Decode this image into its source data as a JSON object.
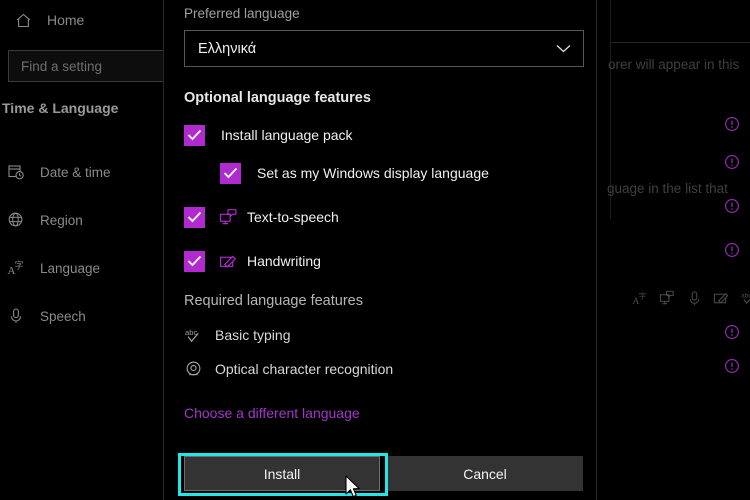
{
  "sidebar": {
    "home": {
      "label": "Home",
      "icon": "home-icon"
    },
    "search": {
      "placeholder": "Find a setting"
    },
    "section_title": "Time & Language",
    "items": [
      {
        "label": "Date & time",
        "icon": "calendar-clock-icon"
      },
      {
        "label": "Region",
        "icon": "globe-icon"
      },
      {
        "label": "Language",
        "icon": "language-icon"
      },
      {
        "label": "Speech",
        "icon": "microphone-icon"
      }
    ]
  },
  "background": {
    "text_line_1": "orer will appear in this",
    "text_line_2": "guage in the list that",
    "feature_icons": [
      "language-icon",
      "text-to-speech-icon",
      "microphone-icon",
      "handwriting-icon",
      "basic-typing-icon"
    ]
  },
  "dialog": {
    "preferred_language_label": "Preferred language",
    "language_select": {
      "value": "Ελληνικά",
      "chevron": "chevron-down-icon"
    },
    "optional_header": "Optional language features",
    "optional_features": [
      {
        "label": "Install language pack",
        "checked": true,
        "icon": null,
        "indent": false,
        "info": "info-icon"
      },
      {
        "label": "Set as my Windows display language",
        "checked": true,
        "icon": null,
        "indent": true,
        "info": "info-icon"
      },
      {
        "label": "Text-to-speech",
        "checked": true,
        "icon": "text-to-speech-icon",
        "indent": false,
        "info": "info-icon"
      },
      {
        "label": "Handwriting",
        "checked": true,
        "icon": "handwriting-icon",
        "indent": false,
        "info": "info-icon"
      }
    ],
    "required_header": "Required language features",
    "required_features": [
      {
        "label": "Basic typing",
        "icon": "basic-typing-icon",
        "info": "info-icon"
      },
      {
        "label": "Optical character recognition",
        "icon": "ocr-icon",
        "info": "info-icon"
      }
    ],
    "choose_different_link": "Choose a different language",
    "install_button": "Install",
    "cancel_button": "Cancel"
  },
  "colors": {
    "accent_checkbox": "#b12ad0",
    "accent_link": "#a435c9",
    "focus_ring": "#21e8e8",
    "background": "#000000",
    "button_face": "#333333"
  }
}
